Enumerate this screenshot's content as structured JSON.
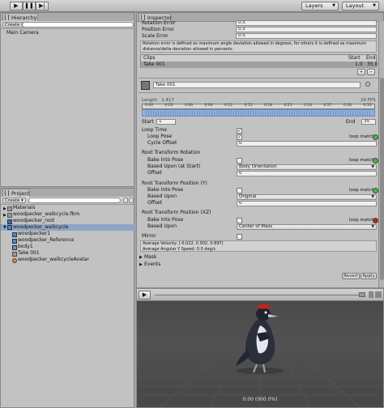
{
  "toolbar": {
    "layers": "Layers",
    "layout": "Layout"
  },
  "hierarchy": {
    "tab": "Hierarchy",
    "create": "Create",
    "items": [
      "Main Camera"
    ]
  },
  "project": {
    "tab": "Project",
    "create": "Create",
    "items": [
      "Materials",
      "woodpecker_walkcycle.fbm",
      "woodpecker_root",
      "woodpecker_walkcycle",
      "woodpecker1",
      "woodpecker_Reference",
      "body1",
      "Take 001",
      "woodpecker_walkcycleAvatar"
    ]
  },
  "inspector": {
    "tab": "Inspector",
    "rotation_error": {
      "label": "Rotation Error",
      "value": "0.5"
    },
    "position_error": {
      "label": "Position Error",
      "value": "0.5"
    },
    "scale_error": {
      "label": "Scale Error",
      "value": "0.5"
    },
    "info": "Rotation error is defined as maximum angle deviation allowed in degrees, for others it is defined as maximum distance/delta deviation allowed in percents",
    "clips_header": {
      "clips": "Clips",
      "start": "Start",
      "end": "End"
    },
    "clip_row": {
      "name": "Take 001",
      "start": "1.0",
      "end": "35.0"
    },
    "clip_name": "Take 001",
    "timeline": {
      "length_label": "Length",
      "length_value": "1.417",
      "fps": "24 FPS",
      "ticks": [
        "0:00",
        "0:03",
        "0:06",
        "0:09",
        "0:12",
        "0:15",
        "0:18",
        "0:21",
        "0:24",
        "0:27",
        "0:30",
        "0:33"
      ]
    },
    "start_label": "Start",
    "start_value": "1",
    "end_label": "End",
    "end_value": "35",
    "loop_time": "Loop Time",
    "loop_pose": "Loop Pose",
    "cycle_offset": "Cycle Offset",
    "cycle_offset_value": "0",
    "loop_match": "loop match",
    "rtr": "Root Transform Rotation",
    "bake_into_pose": "Bake Into Pose",
    "based_upon_start": "Based Upon (at Start)",
    "body_orientation": "Body Orientation",
    "offset": "Offset",
    "offset_value": "0",
    "rtpy": "Root Transform Position (Y)",
    "based_upon": "Based Upon",
    "original": "Original",
    "rtpxz": "Root Transform Position (XZ)",
    "center_of_mass": "Center of Mass",
    "mirror": "Mirror",
    "avg_velocity": "Average Velocity: (-0.022, 0.002, 0.897)",
    "avg_angular": "Average Angular Y Speed: 0.0 deg/s",
    "mask": "Mask",
    "events": "Events",
    "revert": "Revert",
    "apply": "Apply",
    "preview_time": "0:00 (000.0%)",
    "colors": {
      "green": "#33c433",
      "red": "#d21a1a",
      "timeline_blue": "#6f94c8"
    }
  }
}
